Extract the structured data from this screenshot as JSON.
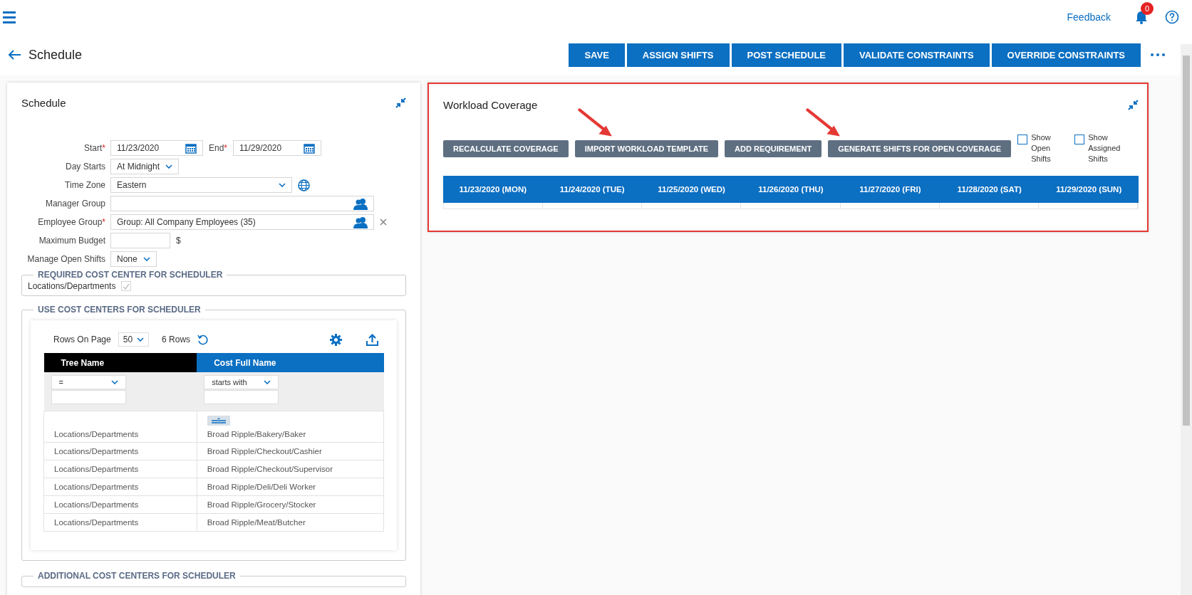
{
  "header": {
    "feedback": "Feedback",
    "notification_count": "0"
  },
  "page": {
    "title": "Schedule"
  },
  "actions": [
    "SAVE",
    "ASSIGN SHIFTS",
    "POST SCHEDULE",
    "VALIDATE CONSTRAINTS",
    "OVERRIDE CONSTRAINTS"
  ],
  "schedule_panel": {
    "title": "Schedule",
    "form_rows": [
      {
        "kind": "date",
        "label": "Start",
        "required_mark": "*",
        "value": "11/23/2020",
        "end": {
          "label": "End",
          "required_mark": "*",
          "value": "11/29/2020"
        }
      },
      {
        "kind": "select",
        "label": "Day Starts",
        "value": "At Midnight"
      },
      {
        "kind": "timezone",
        "label": "Time Zone",
        "value": "Eastern"
      },
      {
        "kind": "lookup",
        "label": "Manager Group"
      },
      {
        "kind": "lookup_clear",
        "label": "Employee Group",
        "required_mark": "*",
        "value": "Group: All Company Employees (35)"
      },
      {
        "kind": "money",
        "label": "Maximum Budget",
        "unit": "$"
      },
      {
        "kind": "select",
        "label": "Manage Open Shifts",
        "value": "None"
      }
    ],
    "required_cost_center": {
      "legend": "REQUIRED COST CENTER FOR SCHEDULER",
      "label": "Locations/Departments",
      "checked": true,
      "disabled": true
    },
    "use_cost_centers": {
      "legend": "USE COST CENTERS FOR SCHEDULER",
      "rows_on_page_label": "Rows On Page",
      "rows_on_page": "50",
      "row_count": "6 Rows",
      "columns": [
        {
          "label": "Tree Name",
          "selected": false,
          "filter": "="
        },
        {
          "label": "Cost Full Name",
          "selected": true,
          "filter": "starts with"
        }
      ],
      "rows": [
        [
          "Locations/Departments",
          "Broad Ripple/Bakery/Baker"
        ],
        [
          "Locations/Departments",
          "Broad Ripple/Checkout/Cashier"
        ],
        [
          "Locations/Departments",
          "Broad Ripple/Checkout/Supervisor"
        ],
        [
          "Locations/Departments",
          "Broad Ripple/Deli/Deli Worker"
        ],
        [
          "Locations/Departments",
          "Broad Ripple/Grocery/Stocker"
        ],
        [
          "Locations/Departments",
          "Broad Ripple/Meat/Butcher"
        ]
      ]
    },
    "additional_cost_centers": {
      "legend": "ADDITIONAL COST CENTERS FOR SCHEDULER"
    }
  },
  "workload_panel": {
    "title": "Workload Coverage",
    "buttons": [
      "RECALCULATE COVERAGE",
      "IMPORT WORKLOAD TEMPLATE",
      "ADD REQUIREMENT",
      "GENERATE SHIFTS FOR OPEN COVERAGE"
    ],
    "toggles": [
      {
        "label": "Show Open Shifts",
        "checked": false
      },
      {
        "label": "Show Assigned Shifts",
        "checked": false
      }
    ],
    "days": [
      "11/23/2020 (MON)",
      "11/24/2020 (TUE)",
      "11/25/2020 (WED)",
      "11/26/2020 (THU)",
      "11/27/2020 (FRI)",
      "11/28/2020 (SAT)",
      "11/29/2020 (SUN)"
    ]
  }
}
